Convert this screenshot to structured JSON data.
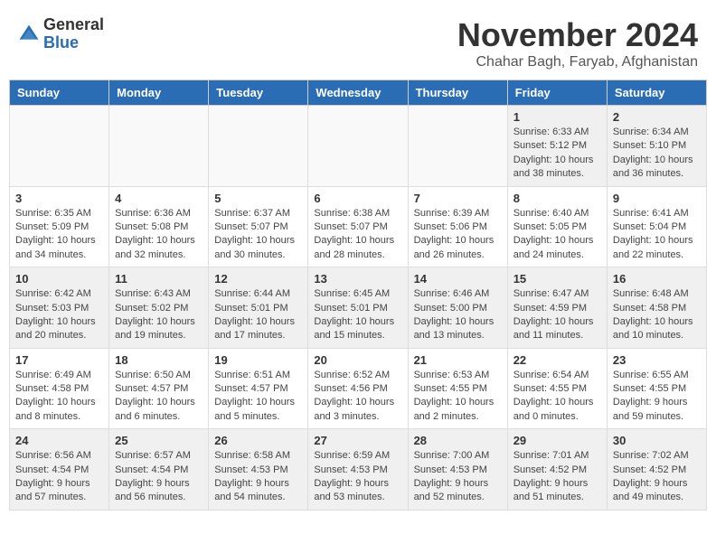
{
  "logo": {
    "general": "General",
    "blue": "Blue"
  },
  "header": {
    "month": "November 2024",
    "location": "Chahar Bagh, Faryab, Afghanistan"
  },
  "weekdays": [
    "Sunday",
    "Monday",
    "Tuesday",
    "Wednesday",
    "Thursday",
    "Friday",
    "Saturday"
  ],
  "weeks": [
    [
      {
        "day": "",
        "info": ""
      },
      {
        "day": "",
        "info": ""
      },
      {
        "day": "",
        "info": ""
      },
      {
        "day": "",
        "info": ""
      },
      {
        "day": "",
        "info": ""
      },
      {
        "day": "1",
        "info": "Sunrise: 6:33 AM\nSunset: 5:12 PM\nDaylight: 10 hours and 38 minutes."
      },
      {
        "day": "2",
        "info": "Sunrise: 6:34 AM\nSunset: 5:10 PM\nDaylight: 10 hours and 36 minutes."
      }
    ],
    [
      {
        "day": "3",
        "info": "Sunrise: 6:35 AM\nSunset: 5:09 PM\nDaylight: 10 hours and 34 minutes."
      },
      {
        "day": "4",
        "info": "Sunrise: 6:36 AM\nSunset: 5:08 PM\nDaylight: 10 hours and 32 minutes."
      },
      {
        "day": "5",
        "info": "Sunrise: 6:37 AM\nSunset: 5:07 PM\nDaylight: 10 hours and 30 minutes."
      },
      {
        "day": "6",
        "info": "Sunrise: 6:38 AM\nSunset: 5:07 PM\nDaylight: 10 hours and 28 minutes."
      },
      {
        "day": "7",
        "info": "Sunrise: 6:39 AM\nSunset: 5:06 PM\nDaylight: 10 hours and 26 minutes."
      },
      {
        "day": "8",
        "info": "Sunrise: 6:40 AM\nSunset: 5:05 PM\nDaylight: 10 hours and 24 minutes."
      },
      {
        "day": "9",
        "info": "Sunrise: 6:41 AM\nSunset: 5:04 PM\nDaylight: 10 hours and 22 minutes."
      }
    ],
    [
      {
        "day": "10",
        "info": "Sunrise: 6:42 AM\nSunset: 5:03 PM\nDaylight: 10 hours and 20 minutes."
      },
      {
        "day": "11",
        "info": "Sunrise: 6:43 AM\nSunset: 5:02 PM\nDaylight: 10 hours and 19 minutes."
      },
      {
        "day": "12",
        "info": "Sunrise: 6:44 AM\nSunset: 5:01 PM\nDaylight: 10 hours and 17 minutes."
      },
      {
        "day": "13",
        "info": "Sunrise: 6:45 AM\nSunset: 5:01 PM\nDaylight: 10 hours and 15 minutes."
      },
      {
        "day": "14",
        "info": "Sunrise: 6:46 AM\nSunset: 5:00 PM\nDaylight: 10 hours and 13 minutes."
      },
      {
        "day": "15",
        "info": "Sunrise: 6:47 AM\nSunset: 4:59 PM\nDaylight: 10 hours and 11 minutes."
      },
      {
        "day": "16",
        "info": "Sunrise: 6:48 AM\nSunset: 4:58 PM\nDaylight: 10 hours and 10 minutes."
      }
    ],
    [
      {
        "day": "17",
        "info": "Sunrise: 6:49 AM\nSunset: 4:58 PM\nDaylight: 10 hours and 8 minutes."
      },
      {
        "day": "18",
        "info": "Sunrise: 6:50 AM\nSunset: 4:57 PM\nDaylight: 10 hours and 6 minutes."
      },
      {
        "day": "19",
        "info": "Sunrise: 6:51 AM\nSunset: 4:57 PM\nDaylight: 10 hours and 5 minutes."
      },
      {
        "day": "20",
        "info": "Sunrise: 6:52 AM\nSunset: 4:56 PM\nDaylight: 10 hours and 3 minutes."
      },
      {
        "day": "21",
        "info": "Sunrise: 6:53 AM\nSunset: 4:55 PM\nDaylight: 10 hours and 2 minutes."
      },
      {
        "day": "22",
        "info": "Sunrise: 6:54 AM\nSunset: 4:55 PM\nDaylight: 10 hours and 0 minutes."
      },
      {
        "day": "23",
        "info": "Sunrise: 6:55 AM\nSunset: 4:55 PM\nDaylight: 9 hours and 59 minutes."
      }
    ],
    [
      {
        "day": "24",
        "info": "Sunrise: 6:56 AM\nSunset: 4:54 PM\nDaylight: 9 hours and 57 minutes."
      },
      {
        "day": "25",
        "info": "Sunrise: 6:57 AM\nSunset: 4:54 PM\nDaylight: 9 hours and 56 minutes."
      },
      {
        "day": "26",
        "info": "Sunrise: 6:58 AM\nSunset: 4:53 PM\nDaylight: 9 hours and 54 minutes."
      },
      {
        "day": "27",
        "info": "Sunrise: 6:59 AM\nSunset: 4:53 PM\nDaylight: 9 hours and 53 minutes."
      },
      {
        "day": "28",
        "info": "Sunrise: 7:00 AM\nSunset: 4:53 PM\nDaylight: 9 hours and 52 minutes."
      },
      {
        "day": "29",
        "info": "Sunrise: 7:01 AM\nSunset: 4:52 PM\nDaylight: 9 hours and 51 minutes."
      },
      {
        "day": "30",
        "info": "Sunrise: 7:02 AM\nSunset: 4:52 PM\nDaylight: 9 hours and 49 minutes."
      }
    ]
  ]
}
